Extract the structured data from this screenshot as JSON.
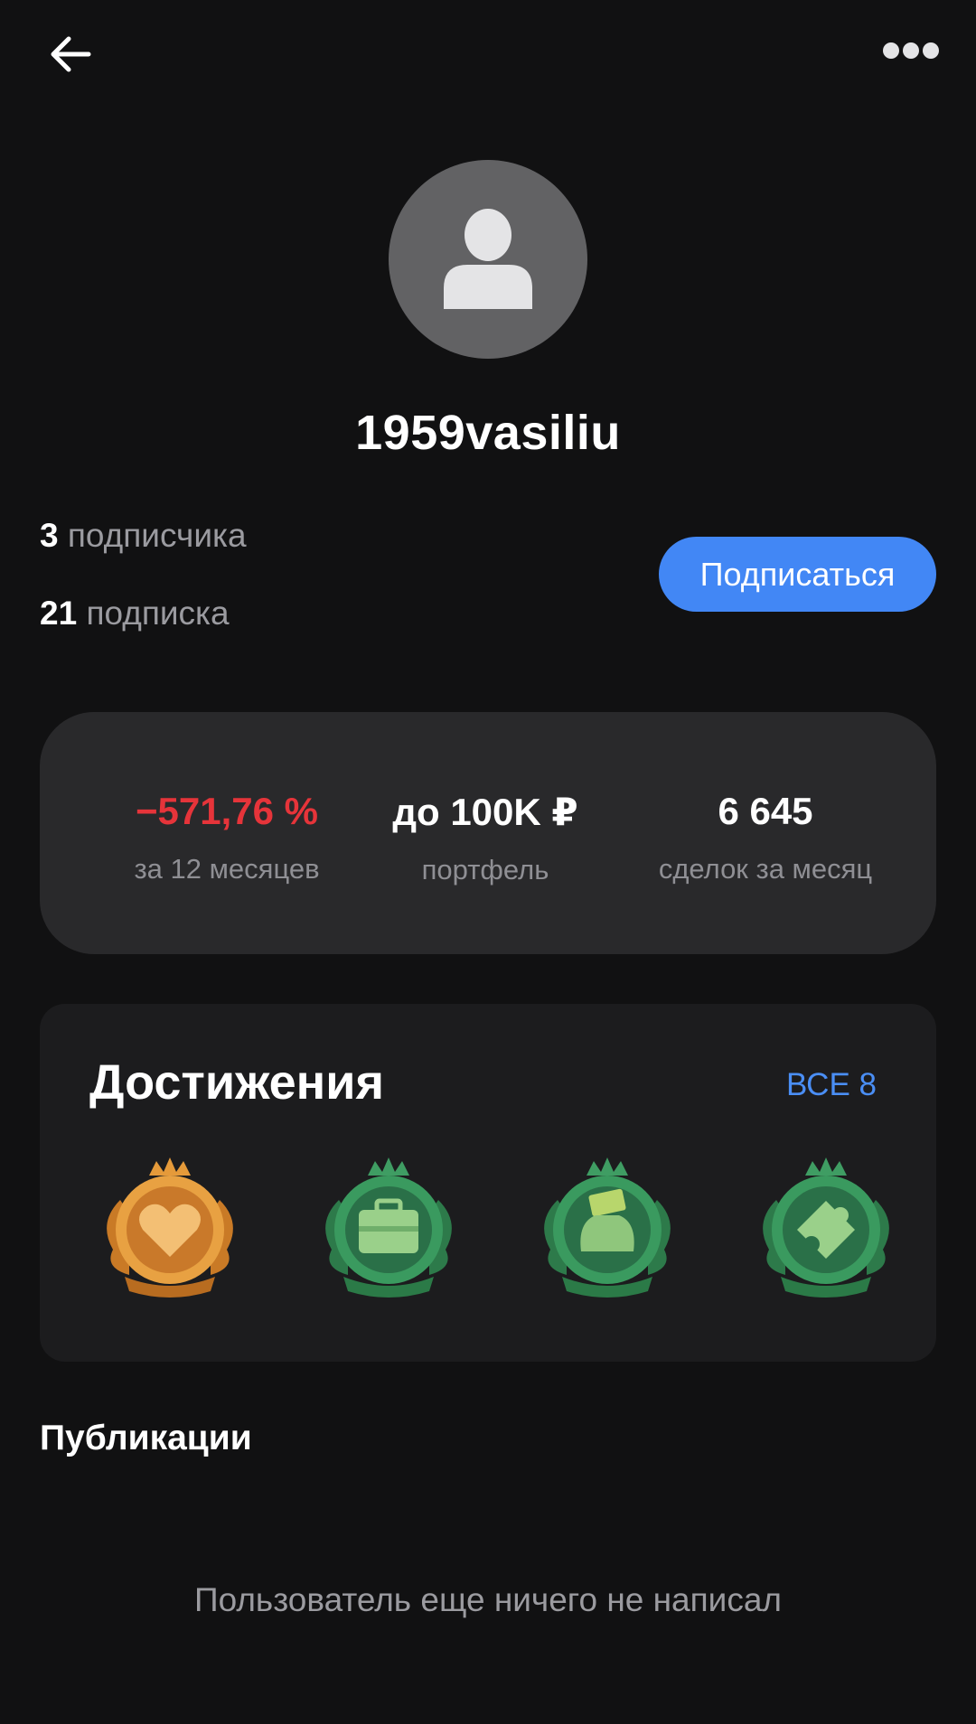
{
  "header": {
    "back_icon": "arrow-left-icon",
    "menu_icon": "more-dots-icon"
  },
  "profile": {
    "username": "1959vasiliu",
    "followers_count": "3",
    "followers_label": "подписчика",
    "following_count": "21",
    "following_label": "подписка",
    "subscribe_label": "Подписаться"
  },
  "stats": [
    {
      "value": "−571,76 %",
      "label": "за 12 месяцев",
      "color": "#e6343a"
    },
    {
      "value": "до 100K ₽",
      "label": "портфель"
    },
    {
      "value": "6 645",
      "label": "сделок за месяц"
    }
  ],
  "achievements": {
    "title": "Достижения",
    "all_label": "ВСЕ 8",
    "badges": [
      {
        "icon": "handshake-badge-icon",
        "color": "#e59a3a"
      },
      {
        "icon": "briefcase-badge-icon",
        "color": "#3f9d63"
      },
      {
        "icon": "money-bag-badge-icon",
        "color": "#3f9d63"
      },
      {
        "icon": "puzzle-badge-icon",
        "color": "#3f9d63"
      }
    ]
  },
  "publications": {
    "title": "Публикации",
    "empty_message": "Пользователь еще ничего не написал"
  },
  "colors": {
    "background": "#111112",
    "card": "#29292b",
    "accent": "#4287f5",
    "negative": "#e6343a"
  }
}
